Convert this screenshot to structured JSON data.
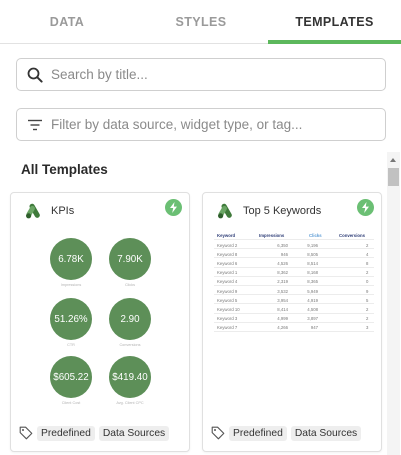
{
  "tabs": [
    {
      "label": "DATA",
      "active": false
    },
    {
      "label": "STYLES",
      "active": false
    },
    {
      "label": "TEMPLATES",
      "active": true
    }
  ],
  "accent_color": "#5cb85c",
  "search": {
    "placeholder": "Search by title...",
    "value": "",
    "icon": "search-icon"
  },
  "filter": {
    "placeholder": "Filter by data source, widget type, or tag...",
    "value": "",
    "icon": "filter-lines-icon"
  },
  "section_title": "All Templates",
  "cards": [
    {
      "title": "KPIs",
      "icon": "google-ads-logo-icon",
      "badge_icon": "lightning-bolt-icon",
      "kpi_color": "#5d8f58",
      "kpis": [
        {
          "value": "6.78K",
          "label": "Impressions"
        },
        {
          "value": "7.90K",
          "label": "Clicks"
        },
        {
          "value": "51.26%",
          "label": "CTR"
        },
        {
          "value": "2.90",
          "label": "Conversions"
        },
        {
          "value": "$605.22",
          "label": "Client Cost"
        },
        {
          "value": "$419.40",
          "label": "Avg. Client CPC"
        }
      ],
      "tags": [
        "Predefined",
        "Data Sources"
      ]
    },
    {
      "title": "Top 5 Keywords",
      "icon": "google-ads-logo-icon",
      "badge_icon": "lightning-bolt-icon",
      "table": {
        "headers": [
          "Keyword",
          "Impressions",
          "Clicks",
          "Conversions"
        ],
        "rows": [
          [
            "Keyword 2",
            "6,350",
            "9,196",
            "2"
          ],
          [
            "Keyword 8",
            "946",
            "8,505",
            "4"
          ],
          [
            "Keyword 6",
            "4,526",
            "8,514",
            "8"
          ],
          [
            "Keyword 1",
            "8,362",
            "8,168",
            "2"
          ],
          [
            "Keyword 4",
            "2,319",
            "8,365",
            "0"
          ],
          [
            "Keyword 9",
            "3,532",
            "5,949",
            "9"
          ],
          [
            "Keyword 5",
            "3,954",
            "4,919",
            "5"
          ],
          [
            "Keyword 10",
            "8,414",
            "4,508",
            "2"
          ],
          [
            "Keyword 3",
            "4,999",
            "3,897",
            "2"
          ],
          [
            "Keyword 7",
            "4,266",
            "947",
            "3"
          ]
        ]
      },
      "tags": [
        "Predefined",
        "Data Sources"
      ]
    }
  ]
}
